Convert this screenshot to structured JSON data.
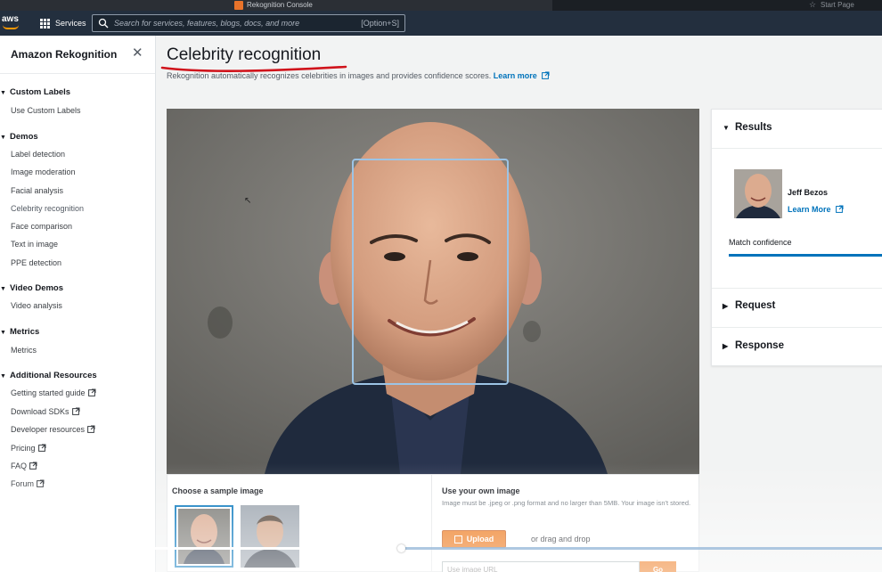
{
  "browser": {
    "tab_title": "Rekognition Console",
    "other_tab_title": "Start Page"
  },
  "nav": {
    "services_label": "Services",
    "search_placeholder": "Search for services, features, blogs, docs, and more",
    "search_shortcut": "[Option+S]"
  },
  "sidebar": {
    "title": "Amazon Rekognition",
    "sections": [
      {
        "label": "Custom Labels",
        "items": [
          {
            "label": "Use Custom Labels"
          }
        ]
      },
      {
        "label": "Demos",
        "items": [
          {
            "label": "Label detection"
          },
          {
            "label": "Image moderation"
          },
          {
            "label": "Facial analysis"
          },
          {
            "label": "Celebrity recognition",
            "active": true
          },
          {
            "label": "Face comparison"
          },
          {
            "label": "Text in image"
          },
          {
            "label": "PPE detection"
          }
        ]
      },
      {
        "label": "Video Demos",
        "items": [
          {
            "label": "Video analysis"
          }
        ]
      },
      {
        "label": "Metrics",
        "items": [
          {
            "label": "Metrics"
          }
        ]
      },
      {
        "label": "Additional Resources",
        "items": [
          {
            "label": "Getting started guide",
            "external": true
          },
          {
            "label": "Download SDKs",
            "external": true
          },
          {
            "label": "Developer resources",
            "external": true
          },
          {
            "label": "Pricing",
            "external": true
          },
          {
            "label": "FAQ",
            "external": true
          },
          {
            "label": "Forum",
            "external": true
          }
        ]
      }
    ]
  },
  "main": {
    "title": "Celebrity recognition",
    "subtitle": "Rekognition automatically recognizes celebrities in images and provides confidence scores.",
    "learn_more": "Learn more"
  },
  "sample": {
    "title": "Choose a sample image"
  },
  "own_image": {
    "title": "Use your own image",
    "description": "Image must be .jpeg or .png format and no larger than 5MB. Your image isn't stored.",
    "upload_label": "Upload",
    "drag_text": "or drag and drop",
    "url_placeholder": "Use image URL",
    "go_label": "Go"
  },
  "results": {
    "heading": "Results",
    "celebrity_name": "Jeff Bezos",
    "celebrity_link": "Learn More",
    "confidence_label": "Match confidence",
    "confidence_fraction": 1.0,
    "request_heading": "Request",
    "response_heading": "Response"
  },
  "video": {
    "progress_fraction": 0.45
  },
  "colors": {
    "nav_bg": "#232f3e",
    "accent_orange": "#ec7211",
    "link_blue": "#0073bb",
    "annotation_red": "#d0131b"
  }
}
